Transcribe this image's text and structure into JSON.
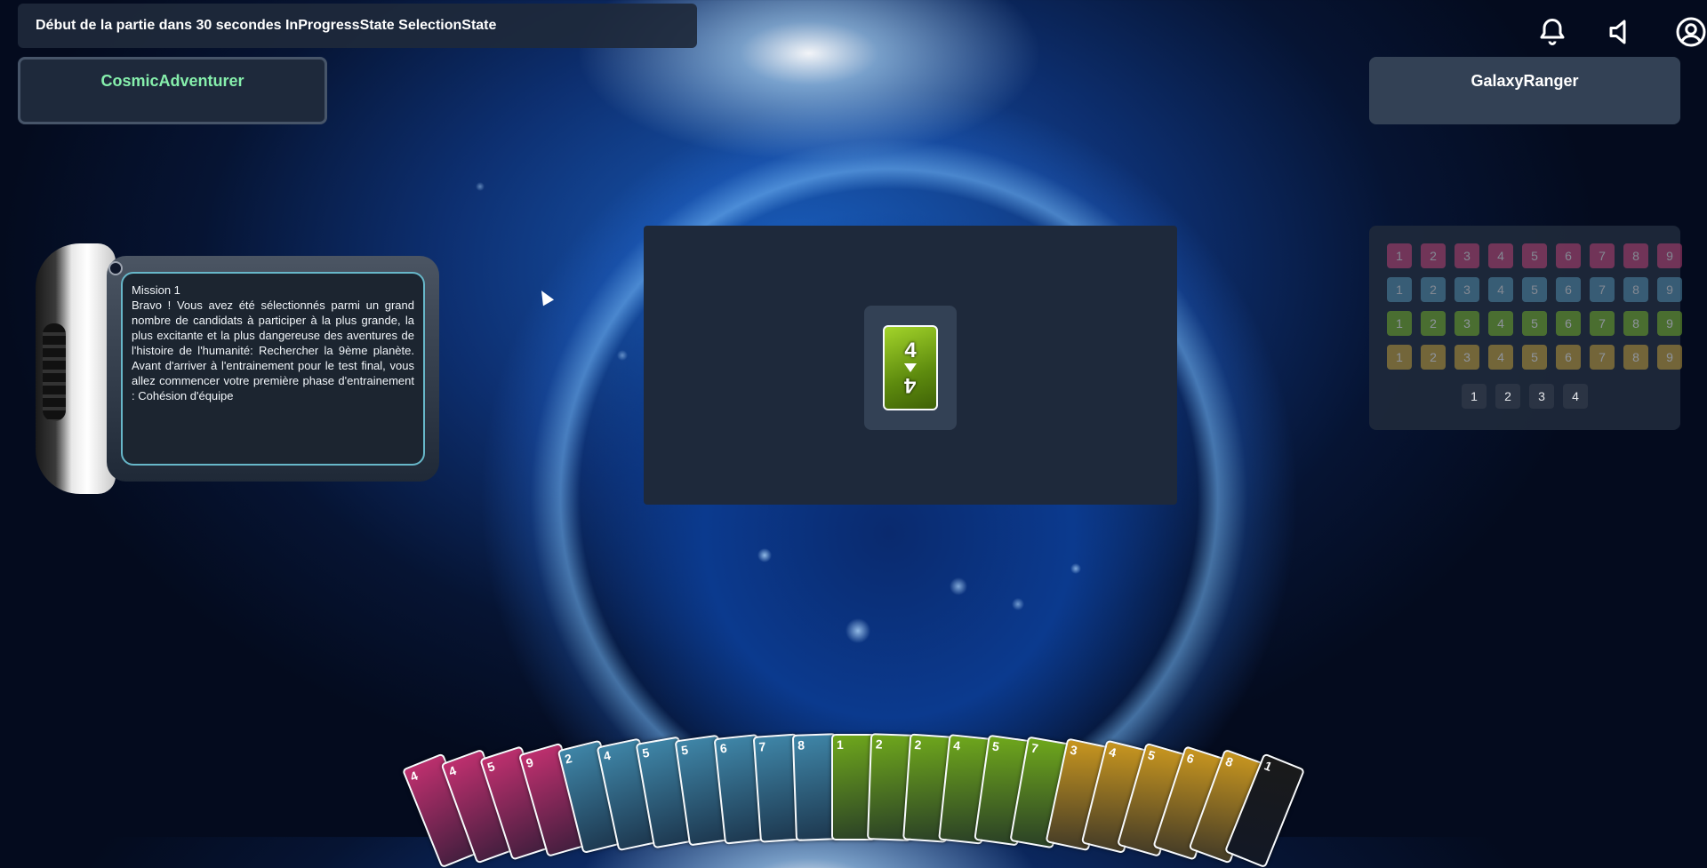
{
  "status": {
    "text": "Début de la partie dans 30 secondes InProgressState SelectionState"
  },
  "icons": {
    "notifications": "bell-icon",
    "sound": "speaker-icon",
    "account": "user-icon"
  },
  "players": {
    "left": {
      "name": "CosmicAdventurer",
      "name_color": "#86efac"
    },
    "right": {
      "name": "GalaxyRanger"
    }
  },
  "mission": {
    "title": "Mission 1",
    "text": "Bravo ! Vous avez été sélectionnés parmi un grand nombre de candidats à participer à la plus grande, la plus excitante et la plus dangereuse des aventures de l'histoire de l'humanité: Rechercher la 9ème planète. Avant d'arriver à l'entrainement pour le test final, vous allez commencer votre première phase d'entrainement : Cohésion d'équipe"
  },
  "center_card": {
    "value": "4",
    "color": "green"
  },
  "tracker": {
    "rows": [
      {
        "color": "pink",
        "values": [
          "1",
          "2",
          "3",
          "4",
          "5",
          "6",
          "7",
          "8",
          "9"
        ]
      },
      {
        "color": "blue",
        "values": [
          "1",
          "2",
          "3",
          "4",
          "5",
          "6",
          "7",
          "8",
          "9"
        ]
      },
      {
        "color": "green",
        "values": [
          "1",
          "2",
          "3",
          "4",
          "5",
          "6",
          "7",
          "8",
          "9"
        ]
      },
      {
        "color": "yellow",
        "values": [
          "1",
          "2",
          "3",
          "4",
          "5",
          "6",
          "7",
          "8",
          "9"
        ]
      }
    ],
    "pages": [
      "1",
      "2",
      "3",
      "4"
    ]
  },
  "colors": {
    "pink": "#c0306f",
    "blue": "#3f86a8",
    "green": "#6fa81c",
    "yellow": "#c8961f",
    "black": "#1a1a1a"
  },
  "hand": [
    {
      "color": "pink",
      "value": "4"
    },
    {
      "color": "pink",
      "value": "4"
    },
    {
      "color": "pink",
      "value": "5"
    },
    {
      "color": "pink",
      "value": "9"
    },
    {
      "color": "blue",
      "value": "2"
    },
    {
      "color": "blue",
      "value": "4"
    },
    {
      "color": "blue",
      "value": "5"
    },
    {
      "color": "blue",
      "value": "5"
    },
    {
      "color": "blue",
      "value": "6"
    },
    {
      "color": "blue",
      "value": "7"
    },
    {
      "color": "blue",
      "value": "8"
    },
    {
      "color": "green",
      "value": "1"
    },
    {
      "color": "green",
      "value": "2"
    },
    {
      "color": "green",
      "value": "2"
    },
    {
      "color": "green",
      "value": "4"
    },
    {
      "color": "green",
      "value": "5"
    },
    {
      "color": "green",
      "value": "7"
    },
    {
      "color": "yellow",
      "value": "3"
    },
    {
      "color": "yellow",
      "value": "4"
    },
    {
      "color": "yellow",
      "value": "5"
    },
    {
      "color": "yellow",
      "value": "6"
    },
    {
      "color": "yellow",
      "value": "8"
    },
    {
      "color": "black",
      "value": "1"
    }
  ]
}
